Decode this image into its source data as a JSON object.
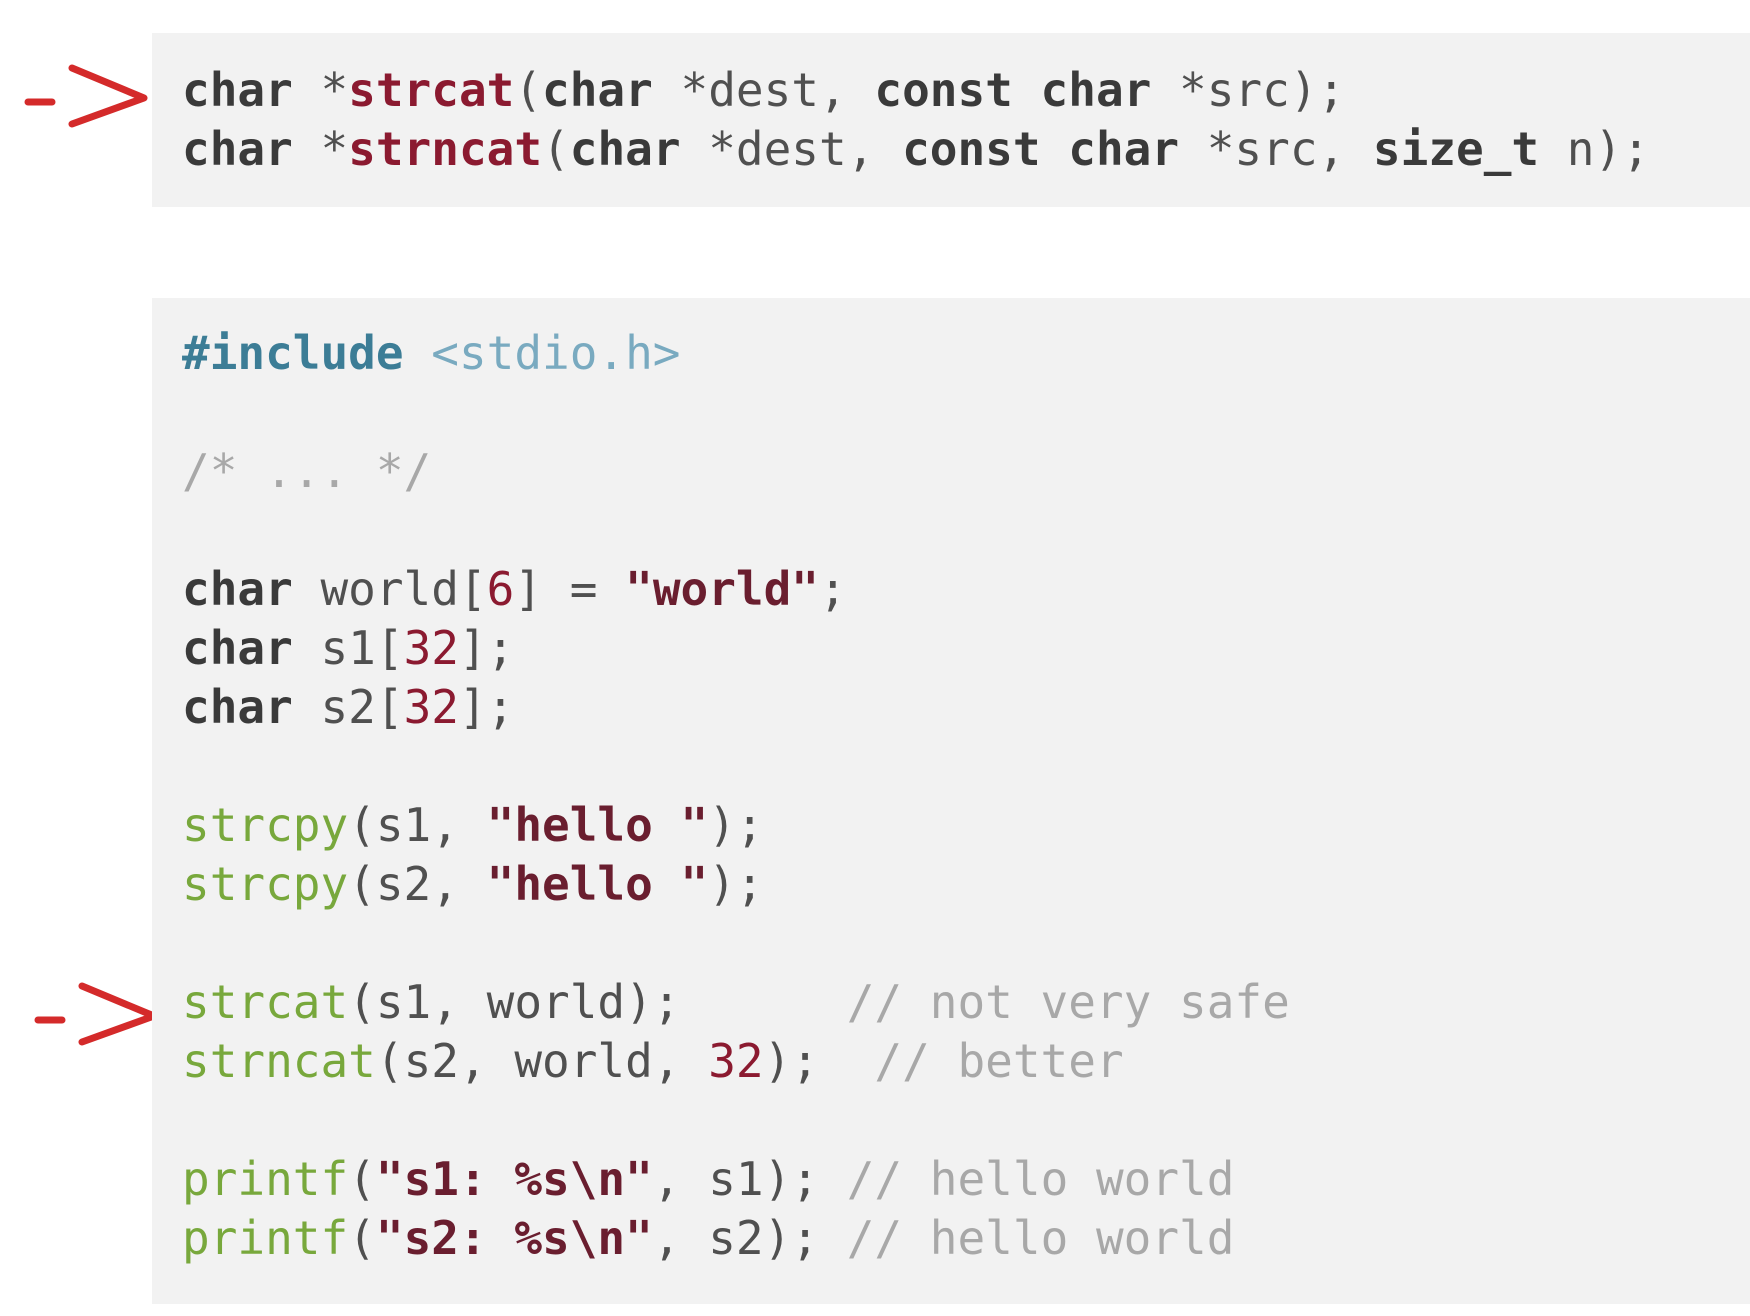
{
  "signatures": {
    "line1": {
      "ret_type": "char",
      "star": " *",
      "fn": "strcat",
      "open": "(",
      "p1_type": "char",
      "p1_name": " *dest, ",
      "p2_type": "const char",
      "p2_name": " *src);"
    },
    "line2": {
      "ret_type": "char",
      "star": " *",
      "fn": "strncat",
      "open": "(",
      "p1_type": "char",
      "p1_name": " *dest, ",
      "p2_type": "const char",
      "p2_name": " *src, ",
      "p3_type": "size_t",
      "p3_name": " n);"
    }
  },
  "code": {
    "include_kw": "#include",
    "include_hdr": " <stdio.h>",
    "comment_elided": "/* ... */",
    "decl_world": {
      "type": "char",
      "name": " world[",
      "size": "6",
      "rest": "] = ",
      "value": "\"world\"",
      "end": ";"
    },
    "decl_s1": {
      "type": "char",
      "name": " s1[",
      "size": "32",
      "end": "];"
    },
    "decl_s2": {
      "type": "char",
      "name": " s2[",
      "size": "32",
      "end": "];"
    },
    "copy1": {
      "fn": "strcpy",
      "args": "(s1, ",
      "value": "\"hello \"",
      "end": ");"
    },
    "copy2": {
      "fn": "strcpy",
      "args": "(s2, ",
      "value": "\"hello \"",
      "end": ");"
    },
    "cat1": {
      "fn": "strcat",
      "args": "(s1, world);",
      "pad": "      ",
      "comment": "// not very safe"
    },
    "cat2": {
      "fn": "strncat",
      "args": "(s2, world, ",
      "num": "32",
      "end": ");",
      "pad": "  ",
      "comment": "// better"
    },
    "print1": {
      "fn": "printf",
      "open": "(",
      "value": "\"s1: %s\\n\"",
      "args": ", s1); ",
      "comment": "// hello world"
    },
    "print2": {
      "fn": "printf",
      "open": "(",
      "value": "\"s2: %s\\n\"",
      "args": ", s2); ",
      "comment": "// hello world"
    }
  },
  "annotations": {
    "arrow_color": "#d42a2a"
  }
}
